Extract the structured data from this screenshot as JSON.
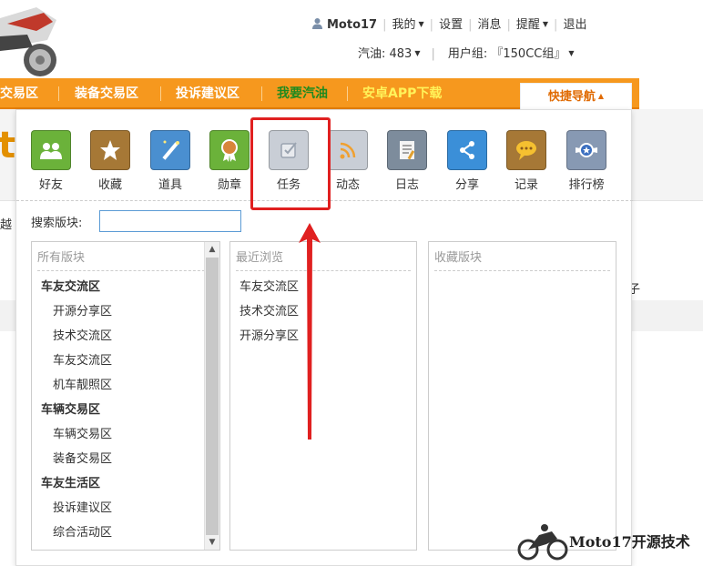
{
  "header": {
    "username": "Moto17",
    "menu": [
      "我的",
      "设置",
      "消息",
      "提醒",
      "退出"
    ],
    "fuel": "汽油: 483",
    "usergroup": "用户组: 『150CC组』"
  },
  "navbar": {
    "items": [
      "车交易区",
      "装备交易区",
      "投诉建议区",
      "我要汽油",
      "安卓APP下载"
    ],
    "quick_nav": "快捷导航"
  },
  "background_fragments": {
    "logo_fragment": "tc",
    "left_fragment": "越",
    "right_fragment": "子"
  },
  "quick_icons": [
    {
      "label": "好友",
      "icon": "friends-icon",
      "color": "#5aa02c"
    },
    {
      "label": "收藏",
      "icon": "star-icon",
      "color": "#9a6a2c"
    },
    {
      "label": "道具",
      "icon": "magic-wand-icon",
      "color": "#3b7fc4"
    },
    {
      "label": "勋章",
      "icon": "medal-icon",
      "color": "#5aa02c"
    },
    {
      "label": "任务",
      "icon": "task-check-icon",
      "color": "#b9c0cc"
    },
    {
      "label": "动态",
      "icon": "rss-icon",
      "color": "#b9c0cc"
    },
    {
      "label": "日志",
      "icon": "journal-icon",
      "color": "#6a7a8c"
    },
    {
      "label": "分享",
      "icon": "share-icon",
      "color": "#3b8fd8"
    },
    {
      "label": "记录",
      "icon": "speech-bubble-icon",
      "color": "#9a6a2c"
    },
    {
      "label": "排行榜",
      "icon": "ranking-badge-icon",
      "color": "#7a8ea8"
    }
  ],
  "search": {
    "label": "搜索版块:",
    "value": ""
  },
  "columns": {
    "all": {
      "title": "所有版块",
      "groups": [
        {
          "name": "车友交流区",
          "items": [
            "开源分享区",
            "技术交流区",
            "车友交流区",
            "机车靓照区"
          ]
        },
        {
          "name": "车辆交易区",
          "items": [
            "车辆交易区",
            "装备交易区"
          ]
        },
        {
          "name": "车友生活区",
          "items": [
            "投诉建议区",
            "综合活动区"
          ]
        }
      ]
    },
    "recent": {
      "title": "最近浏览",
      "items": [
        "车友交流区",
        "技术交流区",
        "开源分享区"
      ]
    },
    "favorites": {
      "title": "收藏版块",
      "items": []
    }
  },
  "watermark": "Moto17开源技术",
  "colors": {
    "nav_orange": "#f6981e",
    "highlight_red": "#e02020",
    "quick_nav_text": "#e06a00"
  }
}
